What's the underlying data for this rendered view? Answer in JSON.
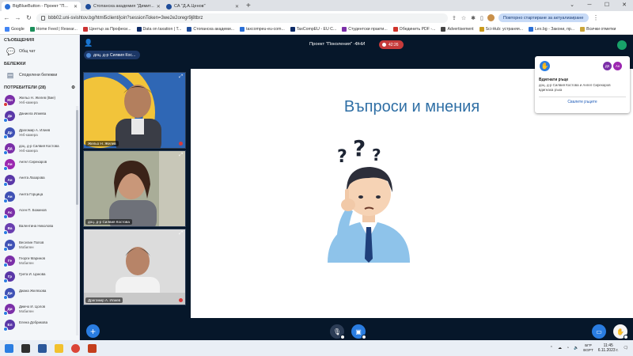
{
  "browser": {
    "tabs": [
      {
        "label": "BigBlueButton - Проект \"П...",
        "active": true,
        "color": "#2a6fd6"
      },
      {
        "label": "Стопанска академия \"Димит...",
        "active": false,
        "color": "#1e4c9a"
      },
      {
        "label": "СА \"Д.А.Ценов\"",
        "active": false,
        "color": "#1e4c9a"
      }
    ],
    "new_tab": "+",
    "url": "bbb02.uni-svishtov.bg/html5client/join?sessionToken=3we2e2oregr9j8tbrz",
    "restart_label": "Повторно стартиране за актуализиране",
    "bookmarks": [
      {
        "label": "Google",
        "color": "#4285f4"
      },
      {
        "label": "Home Feed | Resear...",
        "color": "#1c8f5b"
      },
      {
        "label": "Център за Професи...",
        "color": "#c33"
      },
      {
        "label": "Data on taxation | T...",
        "color": "#0c2a66"
      },
      {
        "label": "Стопанска академи...",
        "color": "#1e4c9a"
      },
      {
        "label": "taxcompeu-eu-com...",
        "color": "#2a6fd6"
      },
      {
        "label": "TaxCompEU - EU C...",
        "color": "#0c2a66"
      },
      {
        "label": "Студентски практи...",
        "color": "#7b2fa8"
      },
      {
        "label": "Обединить PDF -...",
        "color": "#d0342c"
      },
      {
        "label": "Advertisement",
        "color": "#444"
      },
      {
        "label": "Sci-Hub: устраняя...",
        "color": "#c99a1c"
      },
      {
        "label": "Lex.bg - Закони, пр...",
        "color": "#2a6fd6"
      },
      {
        "label": "Всички отметки",
        "color": "#c9a53a"
      }
    ]
  },
  "sidebar": {
    "messages_title": "СЪОБЩЕНИЯ",
    "public_chat": "Общ чат",
    "notes_title": "БЕЛЕЖКИ",
    "shared_notes": "Споделени бележки",
    "users_title": "ПОТРЕБИТЕЛИ (28)",
    "users": [
      {
        "initials": "Жн",
        "name": "Жельо Н. Желев (Вие)",
        "sub": "Уеб-камера",
        "color": "#7b2fa8",
        "badge": "red"
      },
      {
        "initials": "Дк",
        "name": "Даниела Илиева",
        "sub": "",
        "color": "#5a37a8",
        "badge": "blue"
      },
      {
        "initials": "Др",
        "name": "Драгомир А. Илиев",
        "sub": "Уеб-камера",
        "color": "#3f51b5",
        "badge": "blue"
      },
      {
        "initials": "Дд",
        "name": "доц. д-р Силвия Костова",
        "sub": "Уеб-камера",
        "color": "#7b2fa8",
        "badge": "blue"
      },
      {
        "initials": "Ан",
        "name": "Ангел Сирекаров",
        "sub": "",
        "color": "#9c27b0",
        "badge": "blue"
      },
      {
        "initials": "Ан",
        "name": "Анета Лазарова",
        "sub": "",
        "color": "#5a37a8",
        "badge": "blue"
      },
      {
        "initials": "Ан",
        "name": "Анета Горцица",
        "sub": "",
        "color": "#3f51b5",
        "badge": "blue"
      },
      {
        "initials": "Ас",
        "name": "Асен П. Божинов",
        "sub": "",
        "color": "#7b2fa8",
        "badge": "blue"
      },
      {
        "initials": "Ва",
        "name": "Валентина Николова",
        "sub": "",
        "color": "#6a3fb0",
        "badge": "blue"
      },
      {
        "initials": "Ве",
        "name": "Веселин Попов",
        "sub": "Мобилен",
        "color": "#3f51b5",
        "badge": "blue"
      },
      {
        "initials": "Ге",
        "name": "Георги Маринов",
        "sub": "Мобилен",
        "color": "#7b2fa8",
        "badge": "blue"
      },
      {
        "initials": "Гр",
        "name": "Грета И. Цанова",
        "sub": "",
        "color": "#5a37a8",
        "badge": "blue"
      },
      {
        "initials": "Ди",
        "name": "Диана Желязова",
        "sub": "",
        "color": "#3f51b5",
        "badge": "blue"
      },
      {
        "initials": "Ди",
        "name": "Димчо И. Цолов",
        "sub": "Мобилен",
        "color": "#7b2fa8",
        "badge": "blue"
      },
      {
        "initials": "Ел",
        "name": "Елена Добрикова",
        "sub": "",
        "color": "#5a37a8",
        "badge": "blue"
      }
    ]
  },
  "meeting": {
    "title": "Проект \"Поколения\" -ФНИ",
    "recording_time": "42:26",
    "presenter_label": "доц. д-р Силвия Кос..."
  },
  "videos": [
    {
      "name": "Жельо Н. Желев"
    },
    {
      "name": "доц. д-р Силвия Костова"
    },
    {
      "name": "Драгомир А. Илиев"
    }
  ],
  "slide": {
    "title": "Въпроси и мнения"
  },
  "notification": {
    "avatar_1": "ДК",
    "avatar_2": "Ан",
    "title": "Вдигнати ръце",
    "body": "доц. д-р Силвия Костова и Ангел Сирекаров вдигнаха ръка",
    "button": "Свалете ръцете"
  },
  "taskbar": {
    "lang_top": "БГР",
    "lang_bottom": "BGPT",
    "time": "11:45",
    "date": "6.11.2023 г."
  },
  "colors": {
    "dark_bg": "#06172a",
    "accent": "#2a7de1",
    "record": "#c63b3b",
    "slide_title": "#2f6fa5"
  }
}
